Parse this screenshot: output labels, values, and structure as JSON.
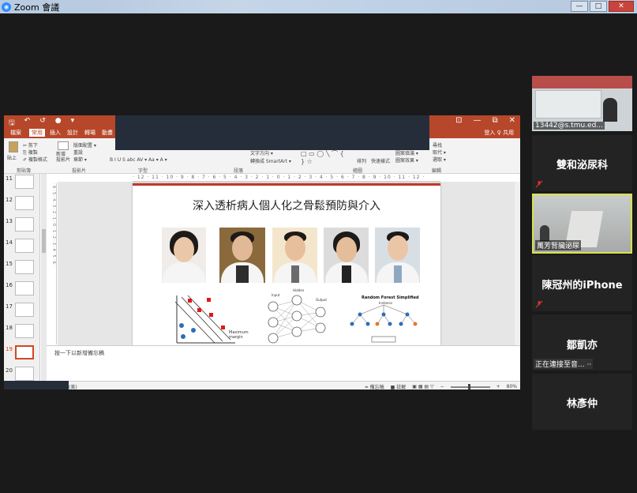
{
  "window": {
    "title": "Zoom 會議",
    "min_label": "—",
    "max_label": "□",
    "close_label": "✕"
  },
  "ppt": {
    "qat": [
      "🖫",
      "↶",
      "↺",
      "●",
      "▾"
    ],
    "controls": [
      "⊡",
      "—",
      "⧉",
      "✕"
    ],
    "tabs": [
      "檔案",
      "常用",
      "插入",
      "設計",
      "轉場",
      "動畫"
    ],
    "tabs_right": "登入  ♀ 共用",
    "ribbon_groups": [
      "剪貼簿",
      "投影片",
      "字型",
      "段落",
      "繪圖",
      "編輯"
    ],
    "ribbon_items": {
      "paste": "貼上",
      "cut": "✂ 剪下",
      "copy": "⎘ 複製",
      "format_painter": "✐ 複製格式",
      "new_slide": "新增\n投影片",
      "layout": "版面配置 ▾",
      "reset": "重設",
      "section": "章節 ▾",
      "text_dir": "文字方向 ▾",
      "smartart": "轉換成 SmartArt ▾",
      "arrange": "排列",
      "quick_styles": "快速樣式",
      "shape_fill": "圖案填滿 ▾",
      "shape_outline": "圖案外框 ▾",
      "shape_effects": "圖案效果 ▾",
      "find": "尋找",
      "replace": "取代 ▾",
      "select": "選取 ▾",
      "font_tools": "B I U S abc AV ▾ Aa ▾ A ▾"
    },
    "ruler_text": "· 12 · 11 · 10 · 9 · 8 · 7 · 6 · 5 · 4 · 3 · 2 · 1 · 0 · 1 · 2 · 3 · 4 · 5 · 6 · 7 · 8 · 9 · 10 · 11 · 12 ·",
    "vruler_text": "· 6 · 5 · 4 · 3 · 2 · 1 · 0 · 1 · 2 · 3 · 4 · 5 · 6 ·",
    "thumbnails": [
      "11",
      "12",
      "13",
      "14",
      "15",
      "16",
      "17",
      "18",
      "19",
      "20"
    ],
    "selected_thumbnail": "19",
    "slide_heading": "深入透析病人個人化之骨鬆預防與介入",
    "fig2_labels": [
      "Input",
      "Hidden",
      "Output"
    ],
    "fig3_title": "Random Forest Simplified",
    "fig3_sub": "Instance",
    "fig1_label": "Maximum\nmargin",
    "notes_placeholder": "按一下以新增備忘稿",
    "status_left": "(美)",
    "status_notes": "≐ 備忘稿",
    "status_comments": "■ 註解",
    "status_zoom": "80%"
  },
  "participants": [
    {
      "id": "p1",
      "label": "13442@s.tmu.ed...",
      "type": "video"
    },
    {
      "id": "p2",
      "name": "雙和泌尿科",
      "muted": true
    },
    {
      "id": "p3",
      "label": "萬芳腎臟泌尿",
      "type": "video",
      "active": true
    },
    {
      "id": "p4",
      "name": "陳冠州的iPhone",
      "muted": true
    },
    {
      "id": "p5",
      "name": "鄒凱亦",
      "status": "正在連接至音... ··"
    },
    {
      "id": "p6",
      "name": "林彥仲"
    }
  ],
  "colors": {
    "ppt_accent": "#b7472a",
    "zoom_active_border": "#d9e24b",
    "muted_red": "#d9342b"
  }
}
